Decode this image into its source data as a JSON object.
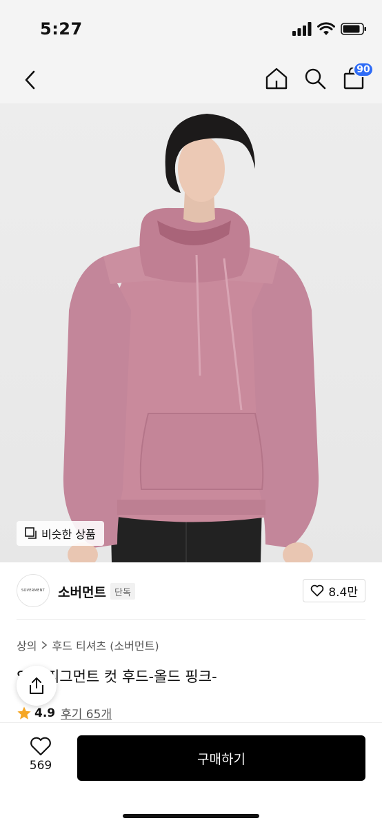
{
  "status_bar": {
    "time": "5:27"
  },
  "nav": {
    "cart_badge": "90"
  },
  "hero": {
    "similar_label": "비슷한 상품"
  },
  "brand": {
    "logo_text": "SOVERMENT",
    "name": "소버먼트",
    "tag": "단독",
    "likes": "8.4만"
  },
  "breadcrumb": {
    "category": "상의",
    "subcategory": "후드 티셔츠 (소버먼트)"
  },
  "product": {
    "title": "S   G 피그먼트 컷 후드-올드 핑크-",
    "rating": "4.9",
    "reviews": "후기 65개"
  },
  "bottom": {
    "wish_count": "569",
    "buy_label": "구매하기"
  },
  "colors": {
    "accent": "#2f6cf6",
    "hoodie": "#c98a9c",
    "buy_button": "#000000",
    "star": "#f5a623"
  },
  "icons": [
    "back-icon",
    "home-icon",
    "search-icon",
    "cart-icon",
    "similar-icon",
    "heart-icon",
    "share-icon",
    "star-icon",
    "chevron-right-icon"
  ]
}
